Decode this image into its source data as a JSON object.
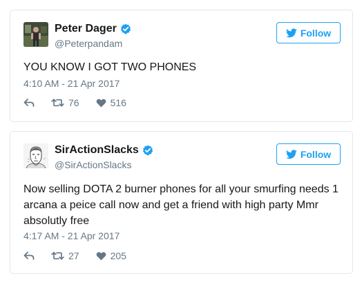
{
  "tweets": [
    {
      "name": "Peter Dager",
      "handle": "@Peterpandam",
      "follow_label": "Follow",
      "text": "YOU KNOW I GOT TWO PHONES",
      "time": "4:10 AM - 21 Apr 2017",
      "retweets": "76",
      "likes": "516"
    },
    {
      "name": "SirActionSlacks",
      "handle": "@SirActionSlacks",
      "follow_label": "Follow",
      "text": "Now selling DOTA 2 burner phones for all your smurfing needs 1 arcana a peice call now and get a friend with high party Mmr absolutly free",
      "time": "4:17 AM - 21 Apr 2017",
      "retweets": "27",
      "likes": "205"
    }
  ],
  "icons": {
    "verified": "verified-badge-icon",
    "follow_bird": "twitter-bird-icon",
    "reply": "reply-arrow-icon",
    "retweet": "retweet-icon",
    "like": "heart-icon"
  },
  "colors": {
    "accent": "#1da1f2",
    "text": "#14171a",
    "muted": "#657786",
    "border": "#e1e8ed"
  }
}
